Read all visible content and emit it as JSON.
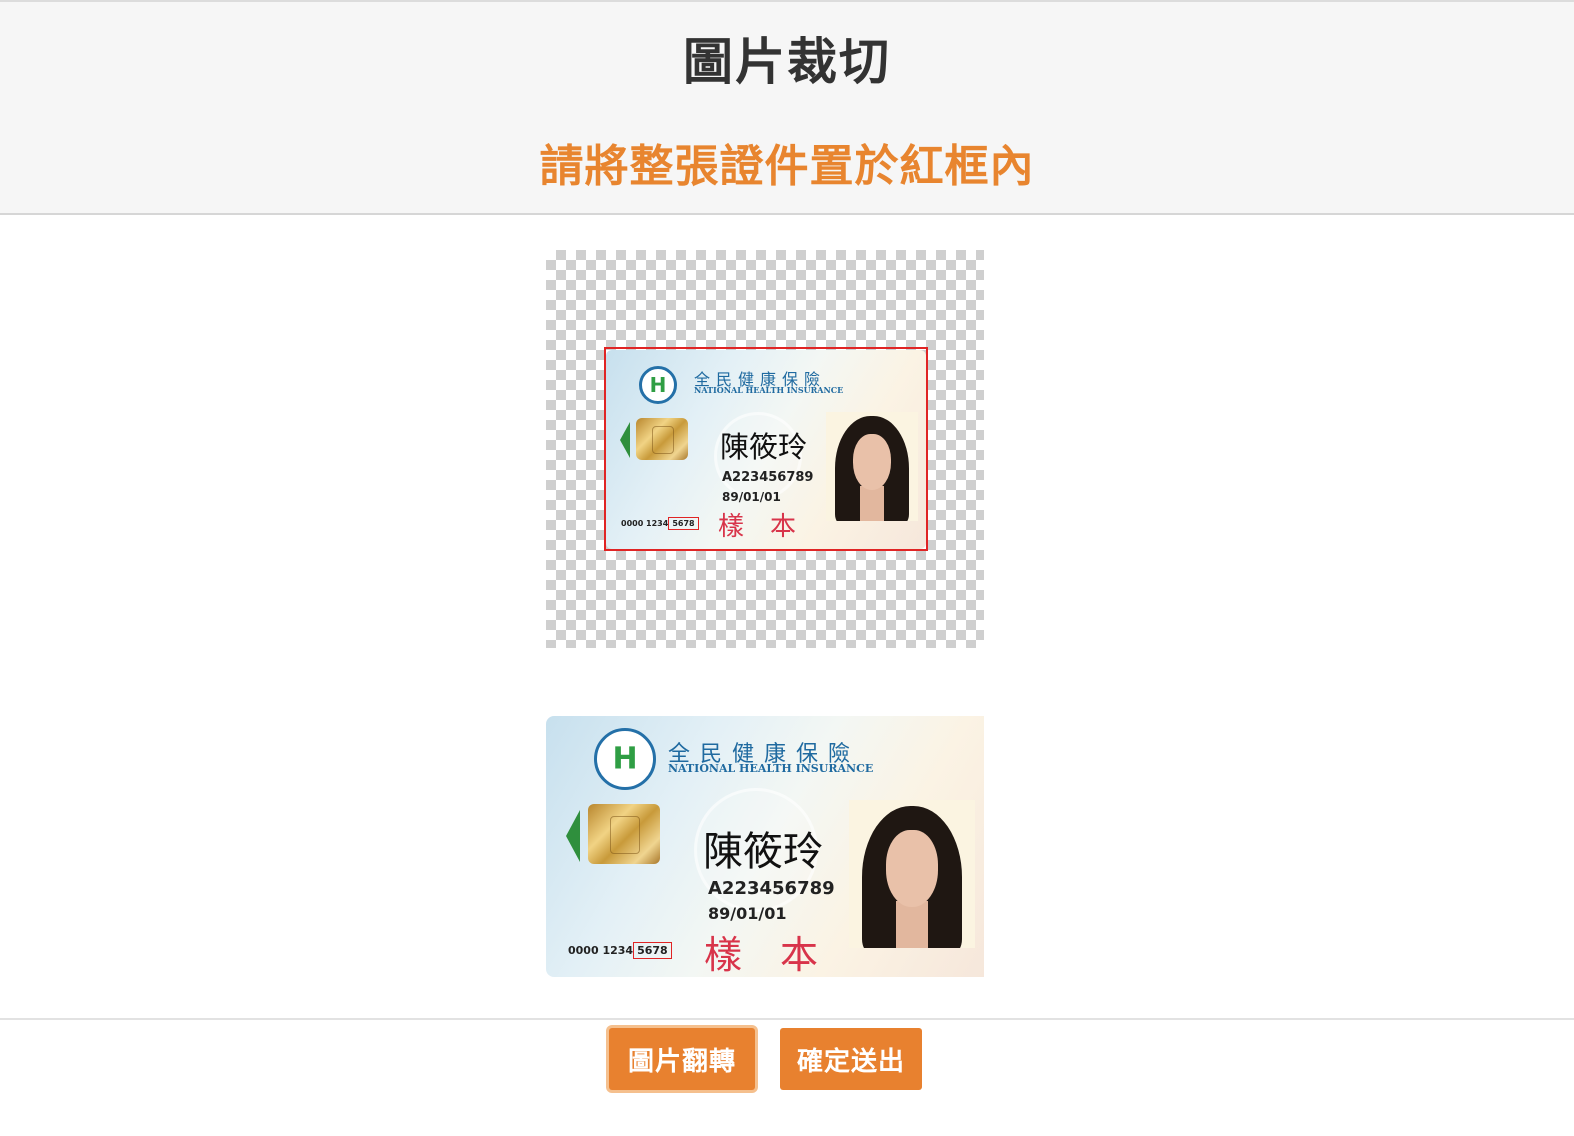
{
  "header": {
    "title": "圖片裁切",
    "instruction": "請將整張證件置於紅框內"
  },
  "card": {
    "org_name_cn": "全民健康保險",
    "org_name_en": "NATIONAL HEALTH INSURANCE",
    "logo_letter": "H",
    "holder_name": "陳筱玲",
    "id_number": "A223456789",
    "birth_date": "89/01/01",
    "sample_mark": "樣　本",
    "card_number_prefix": "0000 1234",
    "card_number_last4": "5678"
  },
  "buttons": {
    "flip_label": "圖片翻轉",
    "submit_label": "確定送出"
  },
  "colors": {
    "accent": "#e8812f",
    "crop_frame": "#e02424",
    "title": "#333333",
    "instruction": "#e8852f"
  },
  "icons": {
    "card_logo": "health-insurance-logo-icon",
    "direction_arrow": "left-arrow-icon"
  }
}
